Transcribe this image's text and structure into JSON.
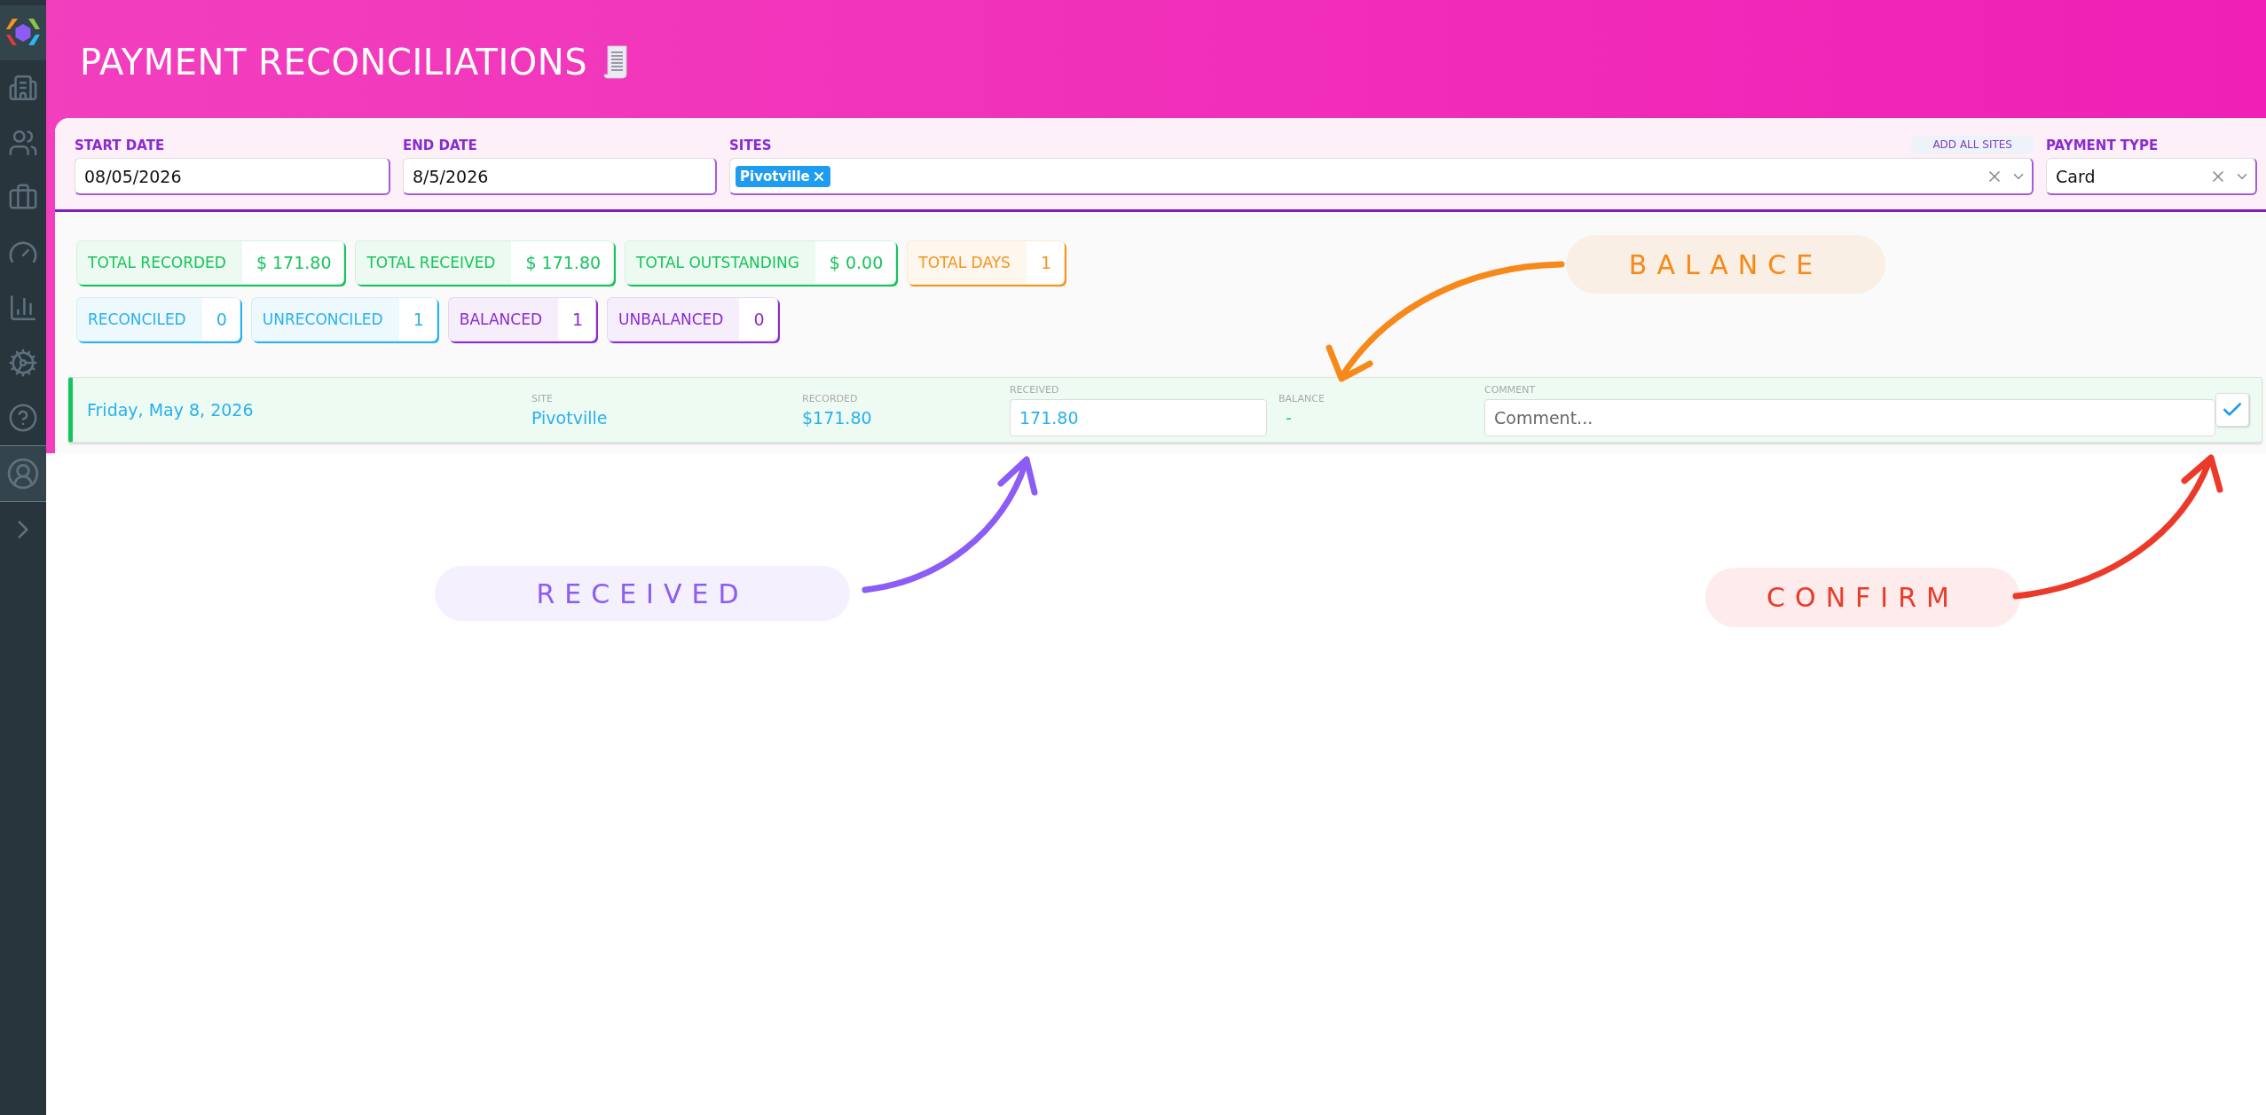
{
  "header": {
    "title": "PAYMENT RECONCILIATIONS"
  },
  "filters": {
    "start_date": {
      "label": "START DATE",
      "value": "08/05/2026"
    },
    "end_date": {
      "label": "END DATE",
      "value": "8/5/2026"
    },
    "sites": {
      "label": "SITES",
      "add_all_button": "ADD ALL SITES",
      "tags": [
        {
          "label": "Pivotville"
        }
      ]
    },
    "payment_type": {
      "label": "PAYMENT TYPE",
      "value": "Card"
    }
  },
  "summary": [
    [
      {
        "label": "TOTAL RECORDED",
        "value": "$ 171.80",
        "color": "#16c45c"
      },
      {
        "label": "TOTAL RECEIVED",
        "value": "$ 171.80",
        "color": "#16c45c"
      },
      {
        "label": "TOTAL OUTSTANDING",
        "value": "$ 0.00",
        "color": "#16c45c"
      },
      {
        "label": "TOTAL DAYS",
        "value": "1",
        "color": "#f7931e"
      }
    ],
    [
      {
        "label": "RECONCILED",
        "value": "0",
        "color": "#29b0ee"
      },
      {
        "label": "UNRECONCILED",
        "value": "1",
        "color": "#29b0ee"
      },
      {
        "label": "BALANCED",
        "value": "1",
        "color": "#8a2bd2"
      },
      {
        "label": "UNBALANCED",
        "value": "0",
        "color": "#8a2bd2"
      }
    ]
  ],
  "rows": [
    {
      "date": "Friday, May 8, 2026",
      "site_label": "SITE",
      "site": "Pivotville",
      "recorded_label": "RECORDED",
      "recorded": "$171.80",
      "received_label": "RECEIVED",
      "received": "171.80",
      "balance_label": "BALANCE",
      "balance": "-",
      "comment_label": "COMMENT",
      "comment_placeholder": "Comment..."
    }
  ],
  "annotations": [
    {
      "label": "BALANCE",
      "color": "#f7891a"
    },
    {
      "label": "RECEIVED",
      "color": "#8b5cf6"
    },
    {
      "label": "CONFIRM",
      "color": "#ec3a2a"
    }
  ]
}
